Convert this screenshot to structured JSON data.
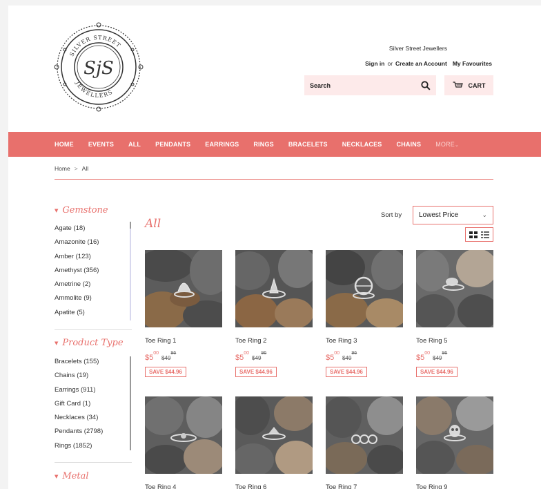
{
  "store": {
    "name": "Silver Street Jewellers"
  },
  "logo": {
    "monogram": "SjS",
    "ring_text": "SILVER STREET JEWELLERS"
  },
  "header": {
    "sign_in": "Sign in",
    "or": "or",
    "create_account": "Create an Account",
    "favourites": "My Favourites",
    "search_placeholder": "Search",
    "cart_label": "CART"
  },
  "nav": {
    "items": [
      "HOME",
      "EVENTS",
      "ALL",
      "PENDANTS",
      "EARRINGS",
      "RINGS",
      "BRACELETS",
      "NECKLACES",
      "CHAINS"
    ],
    "more": "MORE"
  },
  "breadcrumb": {
    "home": "Home",
    "sep": ">",
    "current": "All"
  },
  "filters": {
    "gemstone": {
      "title": "Gemstone",
      "items": [
        "Agate (18)",
        "Amazonite (16)",
        "Amber (123)",
        "Amethyst (356)",
        "Ametrine (2)",
        "Ammolite (9)",
        "Apatite (5)"
      ]
    },
    "product_type": {
      "title": "Product Type",
      "items": [
        "Bracelets (155)",
        "Chains (19)",
        "Earrings (911)",
        "Gift Card (1)",
        "Necklaces (34)",
        "Pendants (2798)",
        "Rings (1852)"
      ]
    },
    "metal": {
      "title": "Metal"
    }
  },
  "collection": {
    "title": "All"
  },
  "sort": {
    "label": "Sort by",
    "selected": "Lowest Price"
  },
  "products": [
    {
      "name": "Toe Ring 1",
      "price_main": "$5",
      "price_cents": "00",
      "orig_main": "$49",
      "orig_cents": "96",
      "save": "SAVE $44.96"
    },
    {
      "name": "Toe Ring 2",
      "price_main": "$5",
      "price_cents": "00",
      "orig_main": "$49",
      "orig_cents": "96",
      "save": "SAVE $44.96"
    },
    {
      "name": "Toe Ring 3",
      "price_main": "$5",
      "price_cents": "00",
      "orig_main": "$49",
      "orig_cents": "96",
      "save": "SAVE $44.96"
    },
    {
      "name": "Toe Ring 5",
      "price_main": "$5",
      "price_cents": "00",
      "orig_main": "$49",
      "orig_cents": "96",
      "save": "SAVE $44.96"
    },
    {
      "name": "Toe Ring 4"
    },
    {
      "name": "Toe Ring 6"
    },
    {
      "name": "Toe Ring 7"
    },
    {
      "name": "Toe Ring 9"
    }
  ],
  "colors": {
    "accent": "#e8706c",
    "search_bg": "#fdeaea"
  }
}
